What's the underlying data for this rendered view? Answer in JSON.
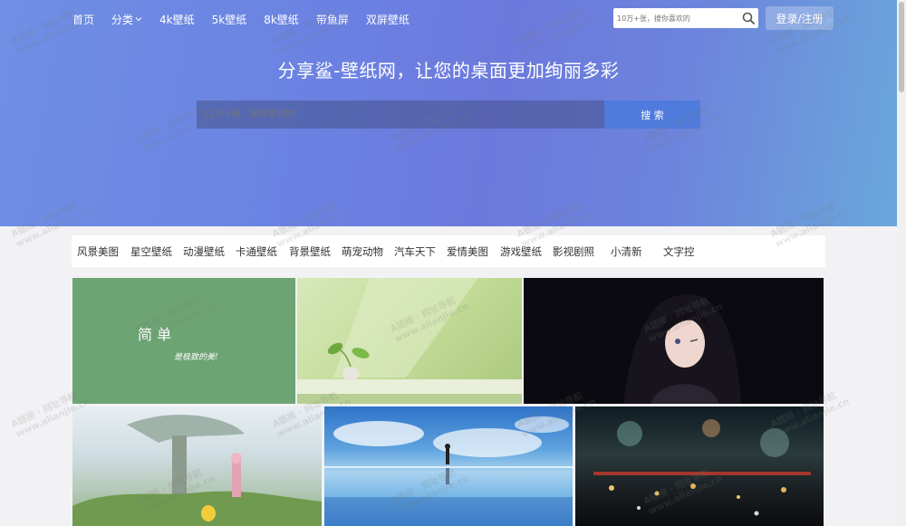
{
  "nav": {
    "items": [
      "首页",
      "分类",
      "4k壁纸",
      "5k壁纸",
      "8k壁纸",
      "带鱼屏",
      "双屏壁纸"
    ]
  },
  "top_search": {
    "placeholder": "10万+张，搜你喜欢的"
  },
  "login_label": "登录/注册",
  "hero": {
    "slogan": "分享鲨-壁纸网，让您的桌面更加绚丽多彩",
    "search_placeholder": "10万+张，搜你喜欢的",
    "search_button": "搜 索"
  },
  "categories": [
    "风景美图",
    "星空壁纸",
    "动漫壁纸",
    "卡通壁纸",
    "背景壁纸",
    "萌宠动物",
    "汽车天下",
    "爱情美图",
    "游戏壁纸",
    "影视剧照",
    "小清新",
    "文字控"
  ],
  "tiles": {
    "tile1_text1": "简 单",
    "tile1_text2": "是极致的美!"
  },
  "watermark": {
    "line1": "A链接 · 网址导航",
    "line2": "www.alianjie.cn"
  },
  "colors": {
    "accent": "#4f7bdc",
    "hero_gradient_start": "#6f8fe4",
    "hero_gradient_end": "#6aa7dc"
  }
}
